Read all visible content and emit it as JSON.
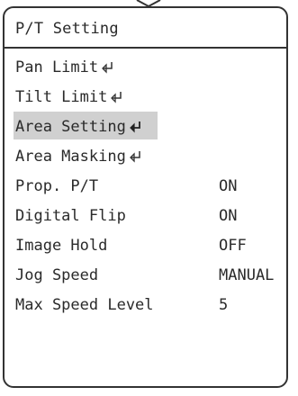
{
  "title": "P/T Setting",
  "items": [
    {
      "label": "Pan Limit",
      "value": "",
      "submenu": true,
      "selected": false
    },
    {
      "label": "Tilt Limit",
      "value": "",
      "submenu": true,
      "selected": false
    },
    {
      "label": "Area Setting",
      "value": "",
      "submenu": true,
      "selected": true
    },
    {
      "label": "Area Masking",
      "value": "",
      "submenu": true,
      "selected": false
    },
    {
      "label": "Prop. P/T",
      "value": "ON",
      "submenu": false,
      "selected": false
    },
    {
      "label": "Digital Flip",
      "value": "ON",
      "submenu": false,
      "selected": false
    },
    {
      "label": "Image Hold",
      "value": "OFF",
      "submenu": false,
      "selected": false
    },
    {
      "label": "Jog Speed",
      "value": "MANUAL",
      "submenu": false,
      "selected": false
    },
    {
      "label": "Max Speed Level",
      "value": "5",
      "submenu": false,
      "selected": false
    }
  ],
  "colors": {
    "highlight": "#d0d0d0",
    "border": "#333333",
    "text": "#2a2a2a"
  },
  "icons": {
    "submenu": "enter-return-icon"
  }
}
